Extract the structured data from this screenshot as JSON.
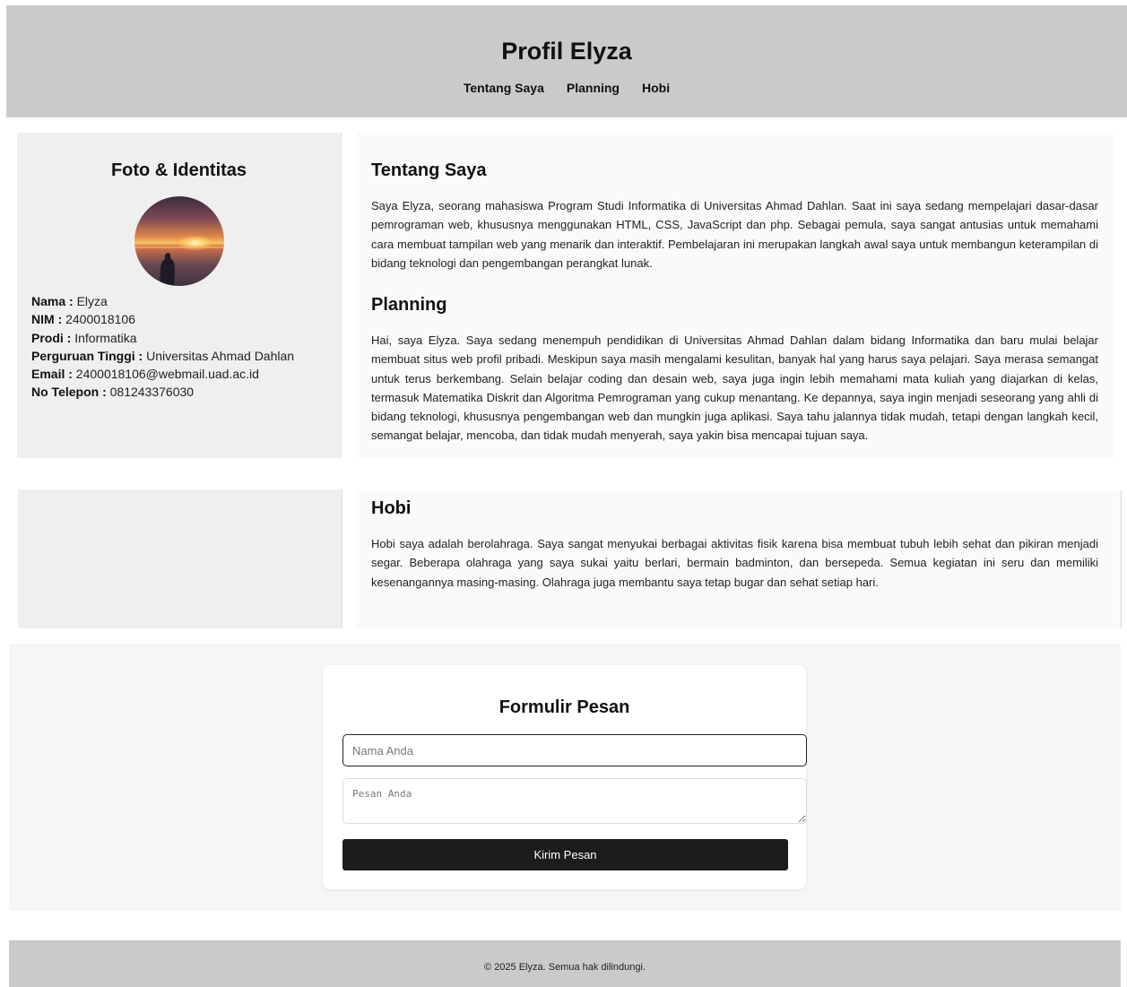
{
  "header": {
    "title": "Profil Elyza",
    "nav": [
      "Tentang Saya",
      "Planning",
      "Hobi"
    ]
  },
  "identity": {
    "title": "Foto & Identitas",
    "fields": [
      {
        "label": "Nama :",
        "value": "Elyza"
      },
      {
        "label": "NIM :",
        "value": "2400018106"
      },
      {
        "label": "Prodi :",
        "value": "Informatika"
      },
      {
        "label": "Perguruan Tinggi :",
        "value": "Universitas Ahmad Dahlan"
      },
      {
        "label": "Email :",
        "value": "2400018106@webmail.uad.ac.id"
      },
      {
        "label": "No Telepon :",
        "value": "081243376030"
      }
    ]
  },
  "about": {
    "title": "Tentang Saya",
    "text": "Saya Elyza, seorang mahasiswa Program Studi Informatika di Universitas Ahmad Dahlan. Saat ini saya sedang mempelajari dasar-dasar pemrograman web, khususnya menggunakan HTML, CSS, JavaScript dan php. Sebagai pemula, saya sangat antusias untuk memahami cara membuat tampilan web yang menarik dan interaktif. Pembelajaran ini merupakan langkah awal saya untuk membangun keterampilan di bidang teknologi dan pengembangan perangkat lunak."
  },
  "planning": {
    "title": "Planning",
    "text": "Hai, saya Elyza. Saya sedang menempuh pendidikan di Universitas Ahmad Dahlan dalam bidang Informatika dan baru mulai belajar membuat situs web profil pribadi. Meskipun saya masih mengalami kesulitan, banyak hal yang harus saya pelajari. Saya merasa semangat untuk terus berkembang. Selain belajar coding dan desain web, saya juga ingin lebih memahami mata kuliah yang diajarkan di kelas, termasuk Matematika Diskrit dan Algoritma Pemrograman yang cukup menantang. Ke depannya, saya ingin menjadi seseorang yang ahli di bidang teknologi, khususnya pengembangan web dan mungkin juga aplikasi. Saya tahu jalannya tidak mudah, tetapi dengan langkah kecil, semangat belajar, mencoba, dan tidak mudah menyerah, saya yakin bisa mencapai tujuan saya."
  },
  "hobby": {
    "title": "Hobi",
    "text": "Hobi saya adalah berolahraga. Saya sangat menyukai berbagai aktivitas fisik karena bisa membuat tubuh lebih sehat dan pikiran menjadi segar. Beberapa olahraga yang saya sukai yaitu berlari, bermain badminton, dan bersepeda. Semua kegiatan ini seru dan memiliki kesenangannya masing-masing. Olahraga juga membantu saya tetap bugar dan sehat setiap hari."
  },
  "form": {
    "title": "Formulir Pesan",
    "name_placeholder": "Nama Anda",
    "message_placeholder": "Pesan Anda",
    "submit_label": "Kirim Pesan"
  },
  "footer": {
    "text": "© 2025 Elyza. Semua hak dilindungi."
  },
  "colors": {
    "header_bg": "#cacaca",
    "button_bg": "#1c1c1e"
  }
}
